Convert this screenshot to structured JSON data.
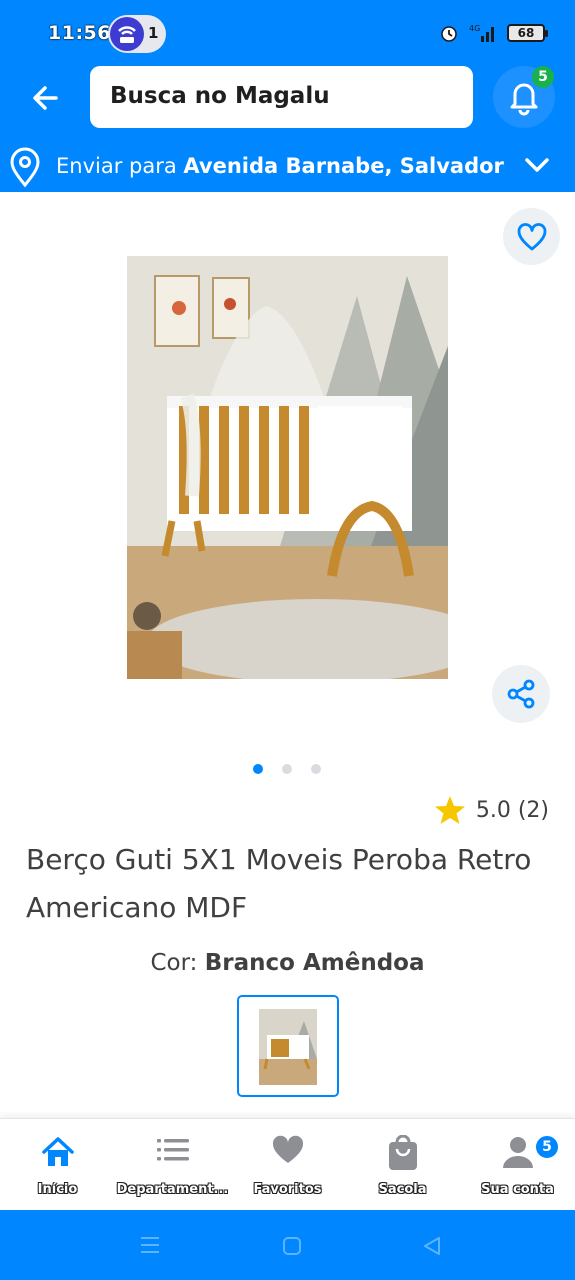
{
  "status_bar": {
    "time": "11:56",
    "hotspot_count": "1",
    "network": "4G",
    "battery": "68"
  },
  "header": {
    "search_placeholder": "Busca no Magalu",
    "notification_count": "5",
    "address_prefix": "Enviar para",
    "address_value": "Avenida Barnabe, Salvador"
  },
  "product": {
    "image_dots": 3,
    "active_dot": 0,
    "rating": "5.0 (2)",
    "title": "Berço Guti 5X1 Moveis Peroba Retro Americano MDF",
    "color_label": "Cor:",
    "color_value": "Branco Amêndoa"
  },
  "bottom_nav": {
    "items": [
      {
        "label": "Início",
        "icon": "home-icon",
        "active": true
      },
      {
        "label": "Departament...",
        "icon": "list-icon"
      },
      {
        "label": "Favoritos",
        "icon": "heart-icon"
      },
      {
        "label": "Sacola",
        "icon": "bag-icon"
      },
      {
        "label": "Sua conta",
        "icon": "user-icon",
        "badge": "5"
      }
    ]
  },
  "colors": {
    "brand_blue": "#0086ff",
    "notification_green": "#18b14b",
    "rating_star": "#f6c700"
  }
}
